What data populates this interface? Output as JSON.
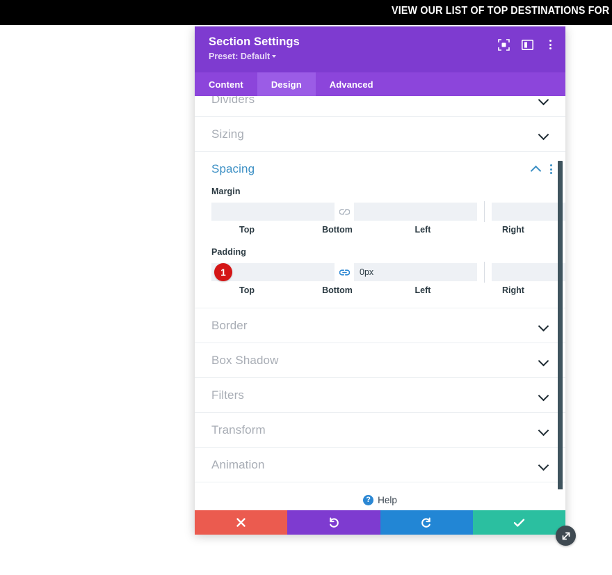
{
  "topbar": {
    "text": "VIEW OUR LIST OF TOP DESTINATIONS FOR THIS YEAR"
  },
  "modal": {
    "title": "Section Settings",
    "preset": "Preset: Default",
    "header_icons": [
      {
        "name": "focus-target-icon"
      },
      {
        "name": "panel-layout-icon"
      },
      {
        "name": "more-options-icon"
      }
    ],
    "tabs": [
      {
        "label": "Content",
        "active": false
      },
      {
        "label": "Design",
        "active": true
      },
      {
        "label": "Advanced",
        "active": false
      }
    ],
    "clipped_section": {
      "label": "Dividers"
    },
    "sections_before": [
      {
        "label": "Sizing"
      }
    ],
    "spacing": {
      "title": "Spacing",
      "collapse_icon": "chevron-up-icon",
      "options_icon": "more-options-icon",
      "groups": [
        {
          "label": "Margin",
          "badge": null,
          "fields": [
            {
              "name": "margin-top",
              "value": "",
              "placeholder": "",
              "sublabel": "Top"
            },
            {
              "name": "margin-bottom",
              "value": "",
              "placeholder": "",
              "sublabel": "Bottom"
            },
            {
              "name": "margin-left",
              "value": "",
              "placeholder": "",
              "sublabel": "Left"
            },
            {
              "name": "margin-right",
              "value": "",
              "placeholder": "",
              "sublabel": "Right"
            }
          ],
          "link_left": {
            "state": "unlinked",
            "icon": "broken-link-icon"
          },
          "link_right": {
            "state": "unlinked",
            "icon": "broken-link-icon"
          }
        },
        {
          "label": "Padding",
          "badge": "1",
          "fields": [
            {
              "name": "padding-top",
              "value": "0px",
              "placeholder": "",
              "sublabel": "Top"
            },
            {
              "name": "padding-bottom",
              "value": "0px",
              "placeholder": "",
              "sublabel": "Bottom"
            },
            {
              "name": "padding-left",
              "value": "",
              "placeholder": "",
              "sublabel": "Left"
            },
            {
              "name": "padding-right",
              "value": "",
              "placeholder": "",
              "sublabel": "Right"
            }
          ],
          "link_left": {
            "state": "linked",
            "icon": "link-icon"
          },
          "link_right": {
            "state": "unlinked",
            "icon": "broken-link-icon"
          }
        }
      ]
    },
    "sections_after": [
      {
        "label": "Border"
      },
      {
        "label": "Box Shadow"
      },
      {
        "label": "Filters"
      },
      {
        "label": "Transform"
      },
      {
        "label": "Animation"
      }
    ],
    "help": {
      "label": "Help",
      "icon": "question-mark-icon"
    },
    "footer_buttons": [
      {
        "name": "cancel-button",
        "icon": "close-x-icon",
        "color": "#eb5b4f"
      },
      {
        "name": "undo-button",
        "icon": "undo-arrow-icon",
        "color": "#7e3bd0"
      },
      {
        "name": "redo-button",
        "icon": "redo-arrow-icon",
        "color": "#2286d5"
      },
      {
        "name": "save-button",
        "icon": "checkmark-icon",
        "color": "#2bbfa0"
      }
    ],
    "resize_handle": {
      "icon": "diagonal-resize-icon"
    }
  },
  "colors": {
    "header_purple": "#7e3bd0",
    "tab_bar_purple": "#8c45db",
    "tab_active_purple": "#9b5ce6",
    "accent_blue": "#3b8fc4",
    "badge_red": "#d41616",
    "save_green": "#2bbfa0"
  }
}
